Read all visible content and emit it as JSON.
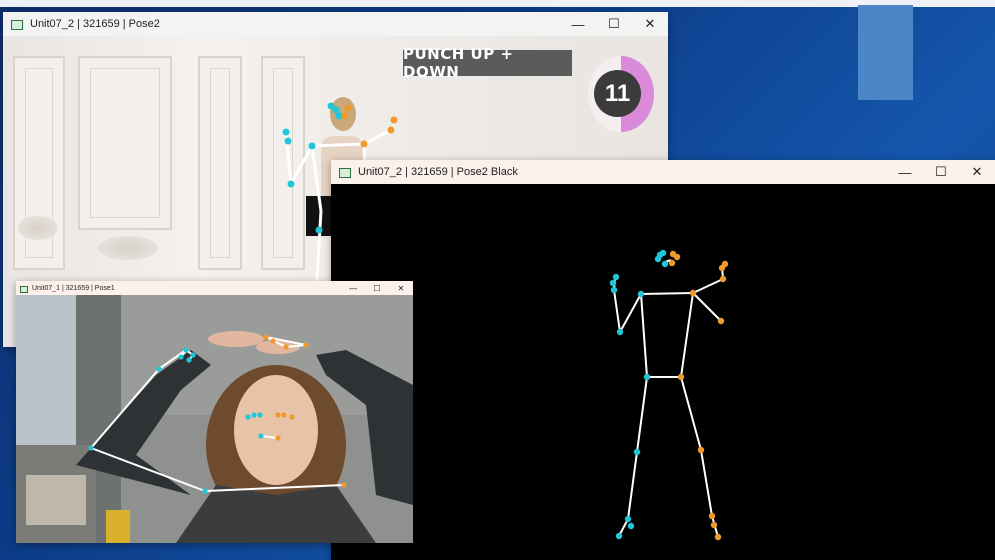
{
  "desktop": {
    "background_colors": [
      "#0f2f6b",
      "#1557ad"
    ]
  },
  "windows": {
    "pose2": {
      "title": "Unit07_2 | 321659 | Pose2",
      "exercise_label": "PUNCH UP + DOWN",
      "rep_count": "11",
      "progress_fraction": 0.5,
      "progress_color": "#d98ad8"
    },
    "pose2_black": {
      "title": "Unit07_2 | 321659 | Pose2 Black"
    },
    "pose1": {
      "title": "Unit07_1 | 321659 | Pose1"
    }
  },
  "window_controls": {
    "minimize": "—",
    "maximize": "☐",
    "close": "✕"
  },
  "keypoint_colors": {
    "left": "#1fc7d8",
    "right": "#ef9a2c",
    "bones": "#ffffff"
  }
}
